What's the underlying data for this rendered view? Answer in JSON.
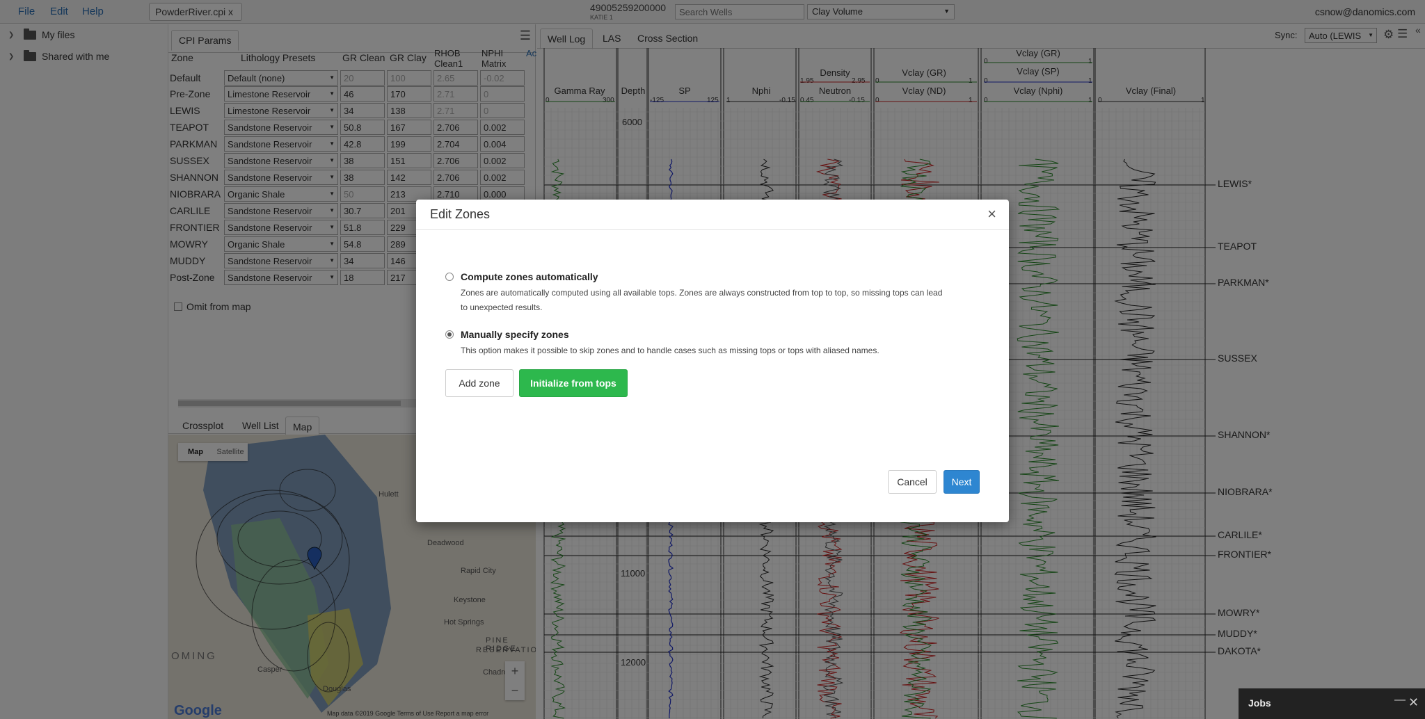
{
  "topbar": {
    "menu": [
      "File",
      "Edit",
      "Help"
    ],
    "file_tab": "PowderRiver.cpi x",
    "well_uwi": "49005259200000",
    "well_name": "KATIE 1",
    "search_placeholder": "Search Wells",
    "curve_select": "Clay Volume",
    "user_email": "csnow@danomics.com"
  },
  "sidebar": {
    "items": [
      {
        "label": "My files",
        "icon": "folder-icon"
      },
      {
        "label": "Shared with me",
        "icon": "folder-icon"
      }
    ]
  },
  "cpi": {
    "tab": "CPI Params",
    "headers": {
      "zone": "Zone",
      "preset": "Lithology Presets",
      "gr_clean": "GR Clean",
      "gr_clay": "GR Clay",
      "rhob_clean_1": "RHOB",
      "rhob_clean_2": "Clean1",
      "nphi_matrix_1": "NPHI",
      "nphi_matrix_2": "Matrix",
      "extra": "Ac"
    },
    "default_row": {
      "zone": "Default",
      "preset": "Default (none)",
      "gr_clean": "20",
      "gr_clay": "100",
      "rhob": "2.65",
      "nphi": "-0.02"
    },
    "rows": [
      {
        "zone": "Pre-Zone",
        "preset": "Limestone Reservoir",
        "gr_clean": "46",
        "gr_clay": "170",
        "rhob": "2.71",
        "nphi": "0"
      },
      {
        "zone": "LEWIS",
        "preset": "Limestone Reservoir",
        "gr_clean": "34",
        "gr_clay": "138",
        "rhob": "2.71",
        "nphi": "0"
      },
      {
        "zone": "TEAPOT",
        "preset": "Sandstone Reservoir",
        "gr_clean": "50.8",
        "gr_clay": "167",
        "rhob": "2.706",
        "nphi": "0.002"
      },
      {
        "zone": "PARKMAN",
        "preset": "Sandstone Reservoir",
        "gr_clean": "42.8",
        "gr_clay": "199",
        "rhob": "2.704",
        "nphi": "0.004"
      },
      {
        "zone": "SUSSEX",
        "preset": "Sandstone Reservoir",
        "gr_clean": "38",
        "gr_clay": "151",
        "rhob": "2.706",
        "nphi": "0.002"
      },
      {
        "zone": "SHANNON",
        "preset": "Sandstone Reservoir",
        "gr_clean": "38",
        "gr_clay": "142",
        "rhob": "2.706",
        "nphi": "0.002"
      },
      {
        "zone": "NIOBRARA",
        "preset": "Organic Shale",
        "gr_clean": "50",
        "gr_clay": "213",
        "rhob": "2.710",
        "nphi": "0.000"
      },
      {
        "zone": "CARLILE",
        "preset": "Sandstone Reservoir",
        "gr_clean": "30.7",
        "gr_clay": "201",
        "rhob": "",
        "nphi": ""
      },
      {
        "zone": "FRONTIER",
        "preset": "Sandstone Reservoir",
        "gr_clean": "51.8",
        "gr_clay": "229",
        "rhob": "",
        "nphi": ""
      },
      {
        "zone": "MOWRY",
        "preset": "Organic Shale",
        "gr_clean": "54.8",
        "gr_clay": "289",
        "rhob": "",
        "nphi": ""
      },
      {
        "zone": "MUDDY",
        "preset": "Sandstone Reservoir",
        "gr_clean": "34",
        "gr_clay": "146",
        "rhob": "",
        "nphi": ""
      },
      {
        "zone": "Post-Zone",
        "preset": "Sandstone Reservoir",
        "gr_clean": "18",
        "gr_clay": "217",
        "rhob": "",
        "nphi": ""
      }
    ],
    "omit_label": "Omit from map"
  },
  "map_panel": {
    "tabs": [
      "Crossplot",
      "Well List",
      "Map"
    ],
    "active_tab": "Map",
    "toggle": [
      "Map",
      "Satellite"
    ],
    "places": [
      "Rapid City",
      "Keystone",
      "Hot Springs",
      "PINE RIDGE",
      "RESERVATION",
      "Casper",
      "Douglas",
      "Chadron",
      "Deadwood",
      "Hulett"
    ],
    "state_label": "OMING",
    "google": "Google",
    "attribution": "Map data ©2019 Google   Terms of Use   Report a map error"
  },
  "log": {
    "tabs": [
      "Well Log",
      "LAS",
      "Cross Section"
    ],
    "active_tab": "Well Log",
    "sync_label": "Sync:",
    "sync_value": "Auto (LEWIS",
    "tracks": {
      "gamma": {
        "name": "Gamma Ray",
        "min": "0",
        "max": "300"
      },
      "depth": {
        "name": "Depth"
      },
      "sp": {
        "name": "SP",
        "min": "-125",
        "max": "125"
      },
      "nphi": {
        "name": "Nphi",
        "min": "1",
        "max": "-0.15"
      },
      "density": {
        "name": "Density",
        "min": "1.95",
        "max": "2.95"
      },
      "neutron": {
        "name": "Neutron",
        "min": "0.45",
        "max": "-0.15"
      },
      "vclay_gr_a": {
        "name": "Vclay (GR)",
        "min": "0",
        "max": "1"
      },
      "vclay_nd": {
        "name": "Vclay (ND)",
        "min": "0",
        "max": "1"
      },
      "vclay_gr_b": {
        "name": "Vclay (GR)",
        "min": "0",
        "max": "1"
      },
      "vclay_sp": {
        "name": "Vclay (SP)",
        "min": "0",
        "max": "1"
      },
      "vclay_nphi": {
        "name": "Vclay (Nphi)",
        "min": "0",
        "max": "1"
      },
      "vclay_final": {
        "name": "Vclay (Final)",
        "min": "0",
        "max": "1"
      }
    },
    "depths": [
      "6000",
      "11000",
      "12000"
    ],
    "tops": [
      "LEWIS*",
      "TEAPOT",
      "PARKMAN*",
      "SUSSEX",
      "SHANNON*",
      "NIOBRARA*",
      "CARLILE*",
      "FRONTIER*",
      "MOWRY*",
      "MUDDY*",
      "DAKOTA*"
    ]
  },
  "modal": {
    "title": "Edit Zones",
    "option_auto_title": "Compute zones automatically",
    "option_auto_desc_1": "Zones are automatically computed using all available tops. Zones are always constructed from top to top, so missing tops can lead",
    "option_auto_desc_2": "to unexpected results.",
    "option_manual_title": "Manually specify zones",
    "option_manual_desc": "This option makes it possible to skip zones and to handle cases such as missing tops or tops with aliased names.",
    "selected": "manual",
    "add_zone": "Add zone",
    "init_tops": "Initialize from tops",
    "cancel": "Cancel",
    "next": "Next"
  },
  "jobs": {
    "label": "Jobs"
  },
  "colors": {
    "accent": "#2e86d1",
    "success": "#2db84d",
    "gr": "#2a8a2a",
    "sp": "#2233cc",
    "density": "#cc2222"
  }
}
